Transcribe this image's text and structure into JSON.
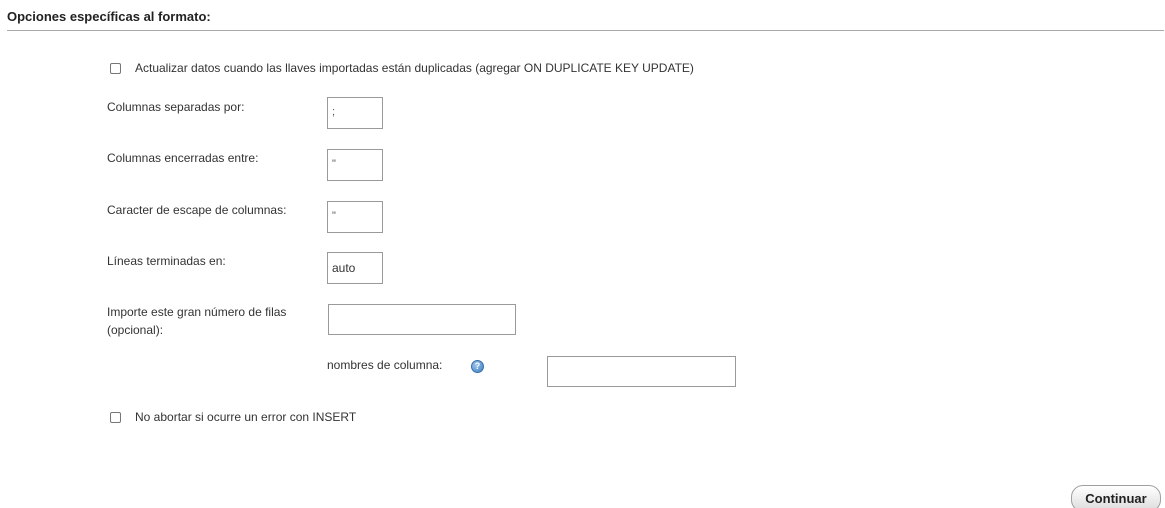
{
  "section": {
    "title": "Opciones específicas al formato:"
  },
  "options": {
    "duplicate_key_label": "Actualizar datos cuando las llaves importadas están duplicadas (agregar ON DUPLICATE KEY UPDATE)",
    "columns_separated_label": "Columnas separadas por:",
    "columns_separated_value": ";",
    "columns_enclosed_label": "Columnas encerradas entre:",
    "columns_enclosed_value": "\"",
    "columns_escape_label": "Caracter de escape de columnas:",
    "columns_escape_value": "\"",
    "lines_terminated_label": "Líneas terminadas en:",
    "lines_terminated_value": "auto",
    "rows_limit_label": "Importe este gran número de filas (opcional):",
    "rows_limit_value": "",
    "column_names_label": "nombres de columna:",
    "column_names_value": "",
    "help_icon": "help-icon",
    "no_abort_label": "No abortar si ocurre un error con INSERT"
  },
  "actions": {
    "continue_label": "Continuar"
  }
}
